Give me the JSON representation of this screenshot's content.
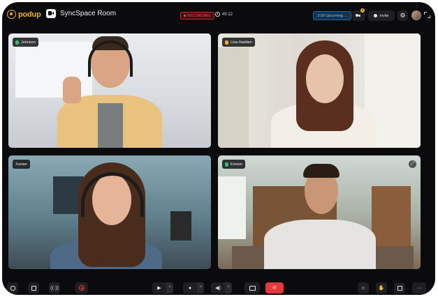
{
  "app": {
    "logo_text": "podup",
    "room_title": "SyncSpace Room"
  },
  "status": {
    "recording_label": "RECORDING",
    "elapsed_time": "45:12",
    "upcoming_label": "3:00 Upcoming ..."
  },
  "header": {
    "participants_count": "2",
    "invite_label": "Invite"
  },
  "participants": [
    {
      "name": "Johnson",
      "speaking": false
    },
    {
      "name": "Lisa Hadden",
      "speaking": true
    },
    {
      "name": "Xuxian",
      "speaking": false
    },
    {
      "name": "Emson",
      "speaking": false
    }
  ],
  "toolbar": {
    "left_icons": [
      "chat-icon",
      "notes-icon",
      "broadcast-icon",
      "record-icon"
    ],
    "center_icons": [
      "camera-icon",
      "microphone-icon",
      "speaker-icon",
      "screen-share-icon",
      "end-call-icon"
    ],
    "right_icons": [
      "emoji-icon",
      "raise-hand-icon",
      "layout-icon",
      "more-icon"
    ]
  },
  "colors": {
    "brand": "#f2b01e",
    "background": "#0b0b0d",
    "recording": "#d3282f",
    "end_call": "#e23a3a",
    "mic_active": "#2fbf71"
  }
}
